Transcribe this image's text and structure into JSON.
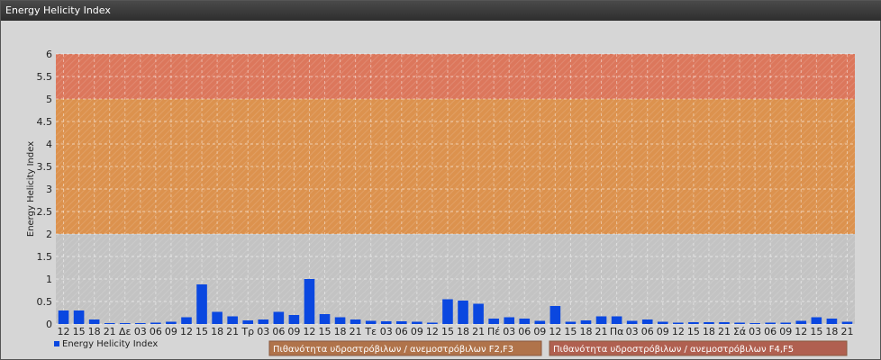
{
  "window": {
    "title": "Energy Helicity Index"
  },
  "chart_data": {
    "type": "bar",
    "ylabel": "Energy Helicity Index",
    "ylim": [
      0,
      6
    ],
    "yticks": [
      "0",
      "0.5",
      "1",
      "1.5",
      "2",
      "2.5",
      "3",
      "3.5",
      "4",
      "4.5",
      "5",
      "5.5",
      "6"
    ],
    "grid": true,
    "categories": [
      "12",
      "15",
      "18",
      "21",
      "Δε",
      "03",
      "06",
      "09",
      "12",
      "15",
      "18",
      "21",
      "Τρ",
      "03",
      "06",
      "09",
      "12",
      "15",
      "18",
      "21",
      "Τε",
      "03",
      "06",
      "09",
      "12",
      "15",
      "18",
      "21",
      "Πέ",
      "03",
      "06",
      "09",
      "12",
      "15",
      "18",
      "21",
      "Πα",
      "03",
      "06",
      "09",
      "12",
      "15",
      "18",
      "21",
      "Σά",
      "03",
      "06",
      "09",
      "12",
      "15",
      "18",
      "21"
    ],
    "series": [
      {
        "name": "Energy Helicity Index",
        "color": "#0a47e0",
        "values": [
          0.3,
          0.3,
          0.1,
          0.02,
          0.02,
          0.02,
          0.03,
          0.05,
          0.15,
          0.88,
          0.27,
          0.17,
          0.08,
          0.1,
          0.27,
          0.2,
          1.0,
          0.22,
          0.15,
          0.1,
          0.07,
          0.06,
          0.06,
          0.05,
          0.03,
          0.55,
          0.52,
          0.45,
          0.12,
          0.15,
          0.12,
          0.07,
          0.4,
          0.05,
          0.08,
          0.17,
          0.17,
          0.07,
          0.1,
          0.05,
          0.03,
          0.04,
          0.04,
          0.04,
          0.03,
          0.02,
          0.03,
          0.03,
          0.07,
          0.15,
          0.12,
          0.05
        ]
      }
    ],
    "bands": [
      {
        "from": 2,
        "to": 5,
        "color": "#e08a3a",
        "label": "Πιθανότητα υδροστρόβιλων / ανεμοστρόβιλων F2,F3",
        "legend_color": "#b0734a"
      },
      {
        "from": 5,
        "to": 6,
        "color": "#e06a4a",
        "label": "Πιθανότητα υδροστρόβιλων / ανεμοστρόβιλων F4,F5",
        "legend_color": "#b06050"
      }
    ],
    "legend": {
      "position": "bottom"
    }
  }
}
